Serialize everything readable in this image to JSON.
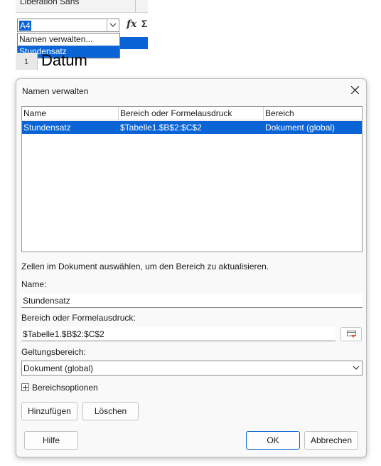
{
  "background": {
    "font_name": "Liberation Sans",
    "name_box_value": "A4",
    "fx_label": "fx",
    "sigma_label": "Σ",
    "name_dropdown": [
      "Namen verwalten...",
      "Stundensatz"
    ],
    "row_number": "1",
    "cell_text": "Datum"
  },
  "dialog": {
    "title": "Namen verwalten",
    "columns": [
      "Name",
      "Bereich oder Formelausdruck",
      "Bereich"
    ],
    "rows": [
      {
        "name": "Stundensatz",
        "range": "$Tabelle1.$B$2:$C$2",
        "scope": "Dokument (global)"
      }
    ],
    "hint": "Zellen im Dokument auswählen, um den Bereich zu aktualisieren.",
    "name_label": "Name:",
    "name_value": "Stundensatz",
    "range_label": "Bereich oder Formelausdruck:",
    "range_value": "$Tabelle1.$B$2:$C$2",
    "scope_label": "Geltungsbereich:",
    "scope_value": "Dokument (global)",
    "options_label": "Bereichsoptionen",
    "add_button": "Hinzufügen",
    "delete_button": "Löschen",
    "help_button": "Hilfe",
    "ok_button": "OK",
    "cancel_button": "Abbrechen"
  },
  "colors": {
    "selection": "#0a64d6",
    "dialog_bg": "#f9f9f9"
  }
}
